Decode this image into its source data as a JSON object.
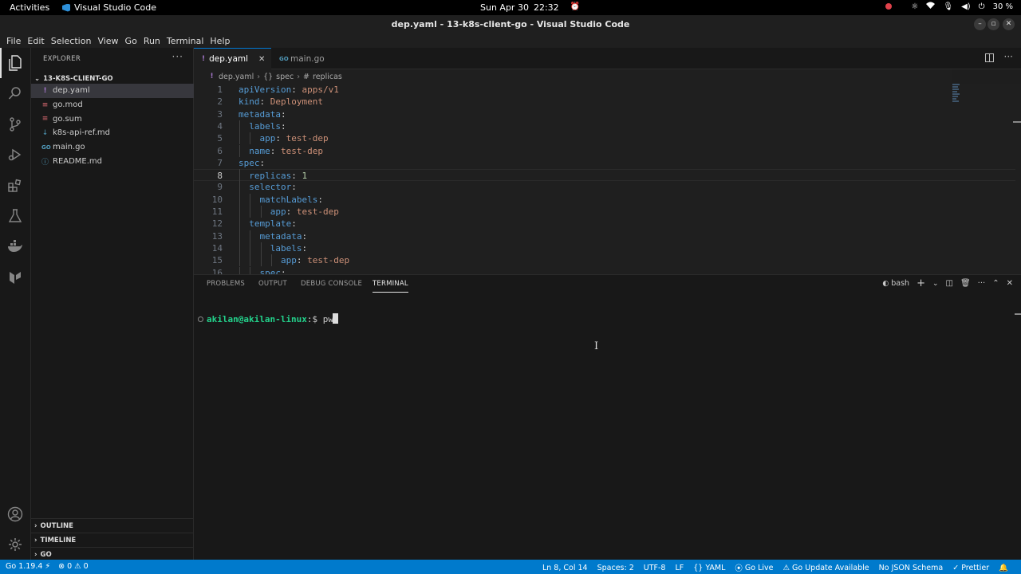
{
  "system": {
    "activities": "Activities",
    "app_name": "Visual Studio Code",
    "date": "Sun Apr 30",
    "time": "22:32",
    "battery": "30 %"
  },
  "window": {
    "title": "dep.yaml - 13-k8s-client-go - Visual Studio Code"
  },
  "menu": [
    "File",
    "Edit",
    "Selection",
    "View",
    "Go",
    "Run",
    "Terminal",
    "Help"
  ],
  "sidebar": {
    "header": "EXPLORER",
    "folder": "13-K8S-CLIENT-GO",
    "files": [
      {
        "name": "dep.yaml",
        "icon": "yaml-icon",
        "glyph": "!"
      },
      {
        "name": "go.mod",
        "icon": "go-mod-icon",
        "glyph": "≡"
      },
      {
        "name": "go.sum",
        "icon": "go-sum-icon",
        "glyph": "≡"
      },
      {
        "name": "k8s-api-ref.md",
        "icon": "markdown-icon",
        "glyph": "↓"
      },
      {
        "name": "main.go",
        "icon": "go-file-icon",
        "glyph": "GO"
      },
      {
        "name": "README.md",
        "icon": "info-icon",
        "glyph": "ⓘ"
      }
    ],
    "sections": [
      "OUTLINE",
      "TIMELINE",
      "GO"
    ]
  },
  "tabs": [
    {
      "label": "dep.yaml",
      "glyph": "!"
    },
    {
      "label": "main.go",
      "glyph": "GO"
    }
  ],
  "breadcrumb": {
    "file": "dep.yaml",
    "item1": "spec",
    "item2": "replicas"
  },
  "code": {
    "lines": [
      {
        "n": "1",
        "indent": "",
        "key": "apiVersion",
        "val": "apps/v1"
      },
      {
        "n": "2",
        "indent": "",
        "key": "kind",
        "val": "Deployment"
      },
      {
        "n": "3",
        "indent": "",
        "key": "metadata",
        "val": ""
      },
      {
        "n": "4",
        "indent": "  ",
        "key": "labels",
        "val": ""
      },
      {
        "n": "5",
        "indent": "    ",
        "key": "app",
        "val": "test-dep"
      },
      {
        "n": "6",
        "indent": "  ",
        "key": "name",
        "val": "test-dep"
      },
      {
        "n": "7",
        "indent": "",
        "key": "spec",
        "val": ""
      },
      {
        "n": "8",
        "indent": "  ",
        "key": "replicas",
        "val": "1"
      },
      {
        "n": "9",
        "indent": "  ",
        "key": "selector",
        "val": ""
      },
      {
        "n": "10",
        "indent": "    ",
        "key": "matchLabels",
        "val": ""
      },
      {
        "n": "11",
        "indent": "      ",
        "key": "app",
        "val": "test-dep"
      },
      {
        "n": "12",
        "indent": "  ",
        "key": "template",
        "val": ""
      },
      {
        "n": "13",
        "indent": "    ",
        "key": "metadata",
        "val": ""
      },
      {
        "n": "14",
        "indent": "      ",
        "key": "labels",
        "val": ""
      },
      {
        "n": "15",
        "indent": "        ",
        "key": "app",
        "val": "test-dep"
      },
      {
        "n": "16",
        "indent": "    ",
        "key": "spec",
        "val": ""
      }
    ],
    "current_line": "8"
  },
  "panel": {
    "tabs": [
      "PROBLEMS",
      "OUTPUT",
      "DEBUG CONSOLE",
      "TERMINAL"
    ],
    "active_tab": "TERMINAL",
    "shell": "bash",
    "prompt_user": "akilan@akilan-linux",
    "prompt_path": ":",
    "prompt_symbol": "$",
    "command": "pw"
  },
  "status": {
    "go_version": "Go 1.19.4",
    "errors": "0",
    "warnings": "0",
    "position": "Ln 8, Col 14",
    "spaces": "Spaces: 2",
    "encoding": "UTF-8",
    "eol": "LF",
    "language": "YAML",
    "golive": "Go Live",
    "go_update": "Go Update Available",
    "schema": "No JSON Schema",
    "prettier": "Prettier"
  }
}
